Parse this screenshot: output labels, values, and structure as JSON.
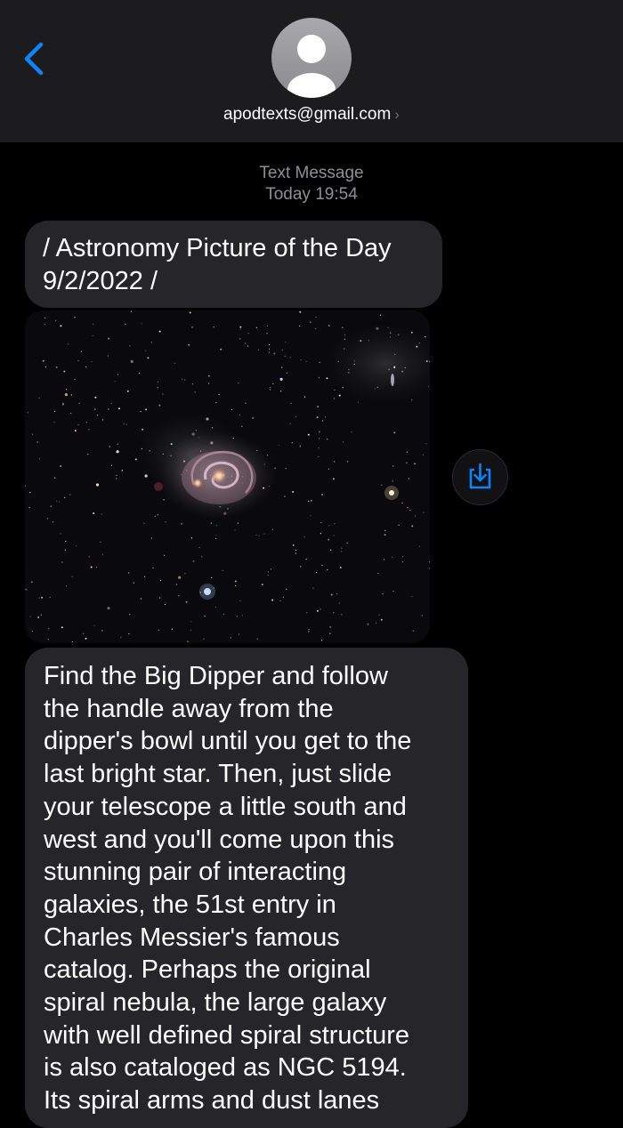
{
  "header": {
    "back_icon": "chevron-left-icon",
    "avatar_icon": "person-silhouette-icon",
    "contact_name": "apodtexts@gmail.com",
    "contact_chevron": "›"
  },
  "conversation": {
    "service_label": "Text Message",
    "timestamp": "Today 19:54"
  },
  "messages": [
    {
      "type": "text",
      "text": "/ Astronomy Picture of the Day\n9/2/2022 /"
    },
    {
      "type": "image",
      "image_subject": "galaxy-m51-photo",
      "save_icon": "save-to-photos-icon"
    },
    {
      "type": "text",
      "text": "Find the Big Dipper and follow\nthe handle away from the\ndipper's bowl until you get to the\nlast bright star. Then, just slide\nyour telescope a little south and\nwest and you'll come upon this\nstunning pair of interacting\ngalaxies, the 51st entry in\nCharles Messier's famous\ncatalog. Perhaps the original\nspiral nebula, the large galaxy\nwith well defined spiral structure\nis also cataloged as NGC 5194.\nIts spiral arms and dust lanes"
    }
  ],
  "colors": {
    "header_bg": "#1c1c1e",
    "bubble_bg": "#26252a",
    "accent_blue": "#0a84ff",
    "meta_text": "#8e8e93"
  }
}
